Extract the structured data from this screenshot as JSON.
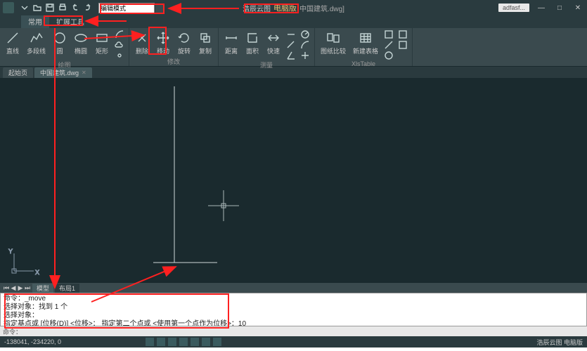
{
  "app": {
    "brand": "浩辰云图",
    "edition": "电脑版",
    "document": "中国建筑.dwg]",
    "user": "adfasf...",
    "search_mode": "编辑模式"
  },
  "tabs": {
    "common": "常用",
    "extend": "扩展工具"
  },
  "ribbon": {
    "draw": {
      "group": "绘图",
      "line": "直线",
      "polyline": "多段线",
      "circle": "圆",
      "ellipse": "椭圆",
      "rect": "矩形"
    },
    "modify": {
      "group": "修改",
      "delete": "删除",
      "move": "移动",
      "rotate": "旋转",
      "copy": "复制"
    },
    "measure": {
      "group": "测量",
      "distance": "距离",
      "area": "面积",
      "quick": "快速"
    },
    "compare": {
      "group": "图纸比较",
      "dwg_compare": "图纸比较",
      "new_table": "新建表格",
      "xls_table": "XlsTable"
    }
  },
  "doc_tabs": {
    "start": "起始页",
    "current": "中国建筑.dwg"
  },
  "layout_tabs": {
    "model": "模型",
    "l1": "布局1"
  },
  "command": {
    "l1": "命令：_move",
    "l2": "选择对象：找到 1 个",
    "l3": "选择对象：",
    "l4": "指定基点或 [位移(D)] <位移>：  指定第二个点或 <使用第一个点作为位移>：10",
    "prompt": "命令："
  },
  "status": {
    "coords": "-138041, -234220, 0",
    "right": "浩辰云图 电脑版"
  }
}
